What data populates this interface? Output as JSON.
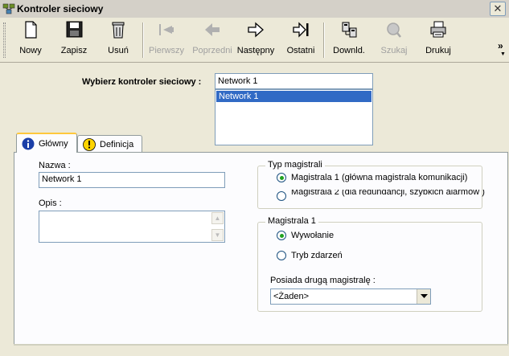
{
  "window": {
    "title": "Kontroler sieciowy",
    "close_glyph": "✕"
  },
  "toolbar": {
    "items": [
      {
        "label": "Nowy",
        "icon": "new-document-icon",
        "enabled": true
      },
      {
        "label": "Zapisz",
        "icon": "floppy-disk-icon",
        "enabled": true
      },
      {
        "label": "Usuń",
        "icon": "trash-can-icon",
        "enabled": true
      },
      {
        "label": "Pierwszy",
        "icon": "first-record-icon",
        "enabled": false
      },
      {
        "label": "Poprzedni",
        "icon": "previous-record-icon",
        "enabled": false
      },
      {
        "label": "Następny",
        "icon": "next-record-icon",
        "enabled": true
      },
      {
        "label": "Ostatni",
        "icon": "last-record-icon",
        "enabled": true
      },
      {
        "label": "Downld.",
        "icon": "download-icon",
        "enabled": true
      },
      {
        "label": "Szukaj",
        "icon": "search-icon",
        "enabled": false
      },
      {
        "label": "Drukuj",
        "icon": "printer-icon",
        "enabled": true
      }
    ],
    "overflow_glyph": "»",
    "overflow_glyph2": "▼"
  },
  "controller": {
    "label": "Wybierz kontroler sieciowy :",
    "value": "Network 1",
    "list": [
      "Network 1"
    ]
  },
  "tabs": [
    {
      "label": "Główny",
      "icon": "info-icon",
      "active": true
    },
    {
      "label": "Definicja",
      "icon": "warning-icon",
      "active": false
    }
  ],
  "form": {
    "name_label": "Nazwa :",
    "name_value": "Network 1",
    "desc_label": "Opis :",
    "desc_value": ""
  },
  "bus_type": {
    "title": "Typ magistrali",
    "options": [
      {
        "label": "Magistrala 1 (główna magistrala komunikacji)",
        "checked": true
      },
      {
        "label": "Magistrala 2 (dla redundancji, szybkich alarmów )",
        "checked": false
      }
    ]
  },
  "bus1": {
    "title": "Magistrala 1",
    "options": [
      {
        "label": "Wywołanie",
        "checked": true
      },
      {
        "label": "Tryb zdarzeń",
        "checked": false
      }
    ],
    "second_label": "Posiada drugą magistralę :",
    "second_value": "<Żaden>"
  },
  "colors": {
    "selection": "#316ac5",
    "tab_highlight": "#ffc83c",
    "background": "#ece9d8"
  }
}
